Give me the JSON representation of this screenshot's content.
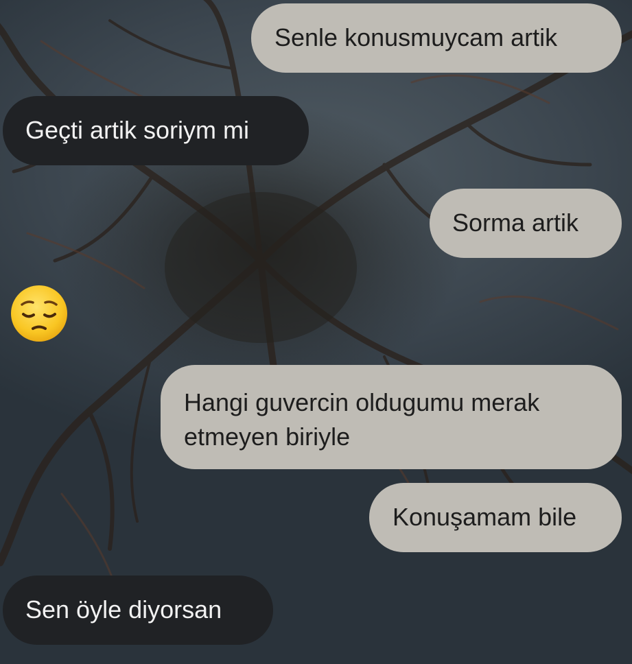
{
  "chat": {
    "messages": [
      {
        "direction": "outgoing",
        "text": "Senle konusmuycam artik"
      },
      {
        "direction": "incoming",
        "text": "Geçti artik soriym mi"
      },
      {
        "direction": "outgoing",
        "text": "Sorma artik"
      },
      {
        "direction": "incoming",
        "emoji": "pensive-face"
      },
      {
        "direction": "outgoing",
        "lines": [
          "Hangi guvercin oldugumu merak",
          "etmeyen biriyle"
        ]
      },
      {
        "direction": "outgoing",
        "text": "Konuşamam bile"
      },
      {
        "direction": "incoming",
        "text": "Sen öyle diyorsan"
      }
    ]
  },
  "colors": {
    "outgoing_bubble": "#bfbcb5",
    "incoming_bubble": "#202225",
    "outgoing_text": "#1d1d1d",
    "incoming_text": "#f2f2f2"
  }
}
